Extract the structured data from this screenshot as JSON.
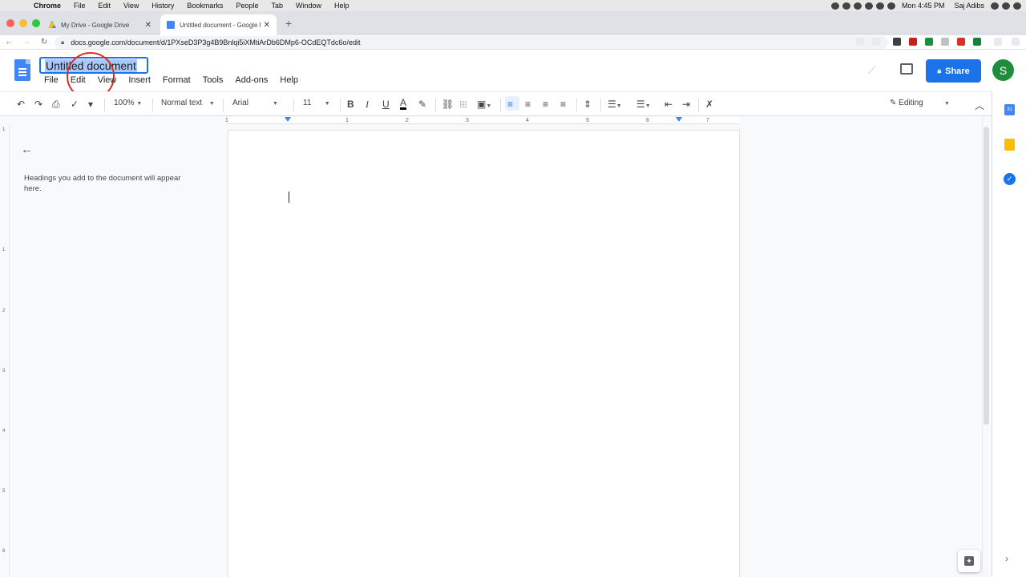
{
  "macos": {
    "menus": [
      "Chrome",
      "File",
      "Edit",
      "View",
      "History",
      "Bookmarks",
      "People",
      "Tab",
      "Window",
      "Help"
    ],
    "clock": "Mon 4:45 PM",
    "user": "Saj Adibs"
  },
  "browser": {
    "tabs": [
      {
        "title": "My Drive - Google Drive",
        "active": false
      },
      {
        "title": "Untitled document - Google Do",
        "active": true
      }
    ],
    "url": "docs.google.com/document/d/1PXseD3P3g4B9Bnlqi5iXMtiArDb6DMp6-OCdEQTdc6o/edit"
  },
  "docs": {
    "title": "Untitled document",
    "menus": [
      "File",
      "Edit",
      "View",
      "Insert",
      "Format",
      "Tools",
      "Add-ons",
      "Help"
    ],
    "share_label": "Share",
    "avatar_initial": "S"
  },
  "toolbar": {
    "zoom": "100%",
    "style": "Normal text",
    "font": "Arial",
    "font_size": "11",
    "mode": "Editing"
  },
  "ruler": {
    "labels": [
      "1",
      "1",
      "2",
      "3",
      "4",
      "5",
      "6",
      "7"
    ],
    "vertical_labels": [
      "1",
      "1",
      "2",
      "3",
      "4",
      "5",
      "6"
    ]
  },
  "outline": {
    "message": "Headings you add to the document will appear here."
  },
  "colors": {
    "accent": "#1a73e8",
    "avatar": "#1e8e3e",
    "selection": "#a8c7fa"
  }
}
